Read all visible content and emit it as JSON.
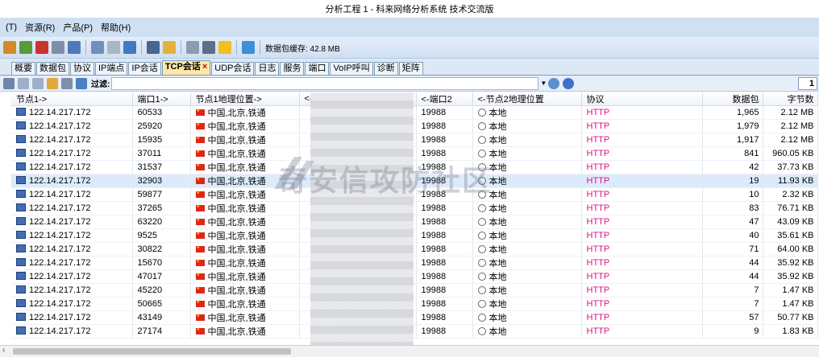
{
  "window": {
    "title": "分析工程 1 - 科来网络分析系统 技术交流版"
  },
  "menu": [
    "(T)",
    "资源(R)",
    "产品(P)",
    "帮助(H)"
  ],
  "toolbar": {
    "buffer_label": "数据包缓存: 42.8 MB"
  },
  "tabs": [
    {
      "label": "概要"
    },
    {
      "label": "数据包"
    },
    {
      "label": "协议"
    },
    {
      "label": "IP端点"
    },
    {
      "label": "IP会话"
    },
    {
      "label": "TCP会话",
      "active": true,
      "close": "×"
    },
    {
      "label": "UDP会话"
    },
    {
      "label": "日志"
    },
    {
      "label": "服务"
    },
    {
      "label": "端口"
    },
    {
      "label": "VoIP呼叫"
    },
    {
      "label": "诊断"
    },
    {
      "label": "矩阵"
    }
  ],
  "filter": {
    "label": "过滤:",
    "value": "",
    "page": "1"
  },
  "columns": {
    "node1": "节点1->",
    "port1": "端口1->",
    "geo1": "节点1地理位置->",
    "node2": "<-",
    "port2": "<-端口2",
    "geo2": "<-节点2地理位置",
    "protocol": "协议",
    "packets": "数据包",
    "bytes": "字节数"
  },
  "rows": [
    {
      "node1": "122.14.217.172",
      "port1": "60533",
      "geo1": "中国,北京,铁通",
      "port2": "19988",
      "geo2": "本地",
      "protocol": "HTTP",
      "packets": "1,965",
      "bytes": "2.12 MB"
    },
    {
      "node1": "122.14.217.172",
      "port1": "25920",
      "geo1": "中国,北京,铁通",
      "port2": "19988",
      "geo2": "本地",
      "protocol": "HTTP",
      "packets": "1,979",
      "bytes": "2.12 MB"
    },
    {
      "node1": "122.14.217.172",
      "port1": "15935",
      "geo1": "中国,北京,铁通",
      "port2": "19988",
      "geo2": "本地",
      "protocol": "HTTP",
      "packets": "1,917",
      "bytes": "2.12 MB"
    },
    {
      "node1": "122.14.217.172",
      "port1": "37011",
      "geo1": "中国,北京,铁通",
      "port2": "19988",
      "geo2": "本地",
      "protocol": "HTTP",
      "packets": "841",
      "bytes": "960.05 KB"
    },
    {
      "node1": "122.14.217.172",
      "port1": "31537",
      "geo1": "中国,北京,铁通",
      "port2": "19988",
      "geo2": "本地",
      "protocol": "HTTP",
      "packets": "42",
      "bytes": "37.73 KB"
    },
    {
      "node1": "122.14.217.172",
      "port1": "32903",
      "geo1": "中国,北京,铁通",
      "port2": "19988",
      "geo2": "本地",
      "protocol": "HTTP",
      "packets": "19",
      "bytes": "11.93 KB",
      "selected": true
    },
    {
      "node1": "122.14.217.172",
      "port1": "59877",
      "geo1": "中国,北京,铁通",
      "port2": "19988",
      "geo2": "本地",
      "protocol": "HTTP",
      "packets": "10",
      "bytes": "2.32 KB"
    },
    {
      "node1": "122.14.217.172",
      "port1": "37265",
      "geo1": "中国,北京,铁通",
      "port2": "19988",
      "geo2": "本地",
      "protocol": "HTTP",
      "packets": "83",
      "bytes": "76.71 KB"
    },
    {
      "node1": "122.14.217.172",
      "port1": "63220",
      "geo1": "中国,北京,铁通",
      "port2": "19988",
      "geo2": "本地",
      "protocol": "HTTP",
      "packets": "47",
      "bytes": "43.09 KB"
    },
    {
      "node1": "122.14.217.172",
      "port1": "9525",
      "geo1": "中国,北京,铁通",
      "port2": "19988",
      "geo2": "本地",
      "protocol": "HTTP",
      "packets": "40",
      "bytes": "35.61 KB"
    },
    {
      "node1": "122.14.217.172",
      "port1": "30822",
      "geo1": "中国,北京,铁通",
      "port2": "19988",
      "geo2": "本地",
      "protocol": "HTTP",
      "packets": "71",
      "bytes": "64.00 KB"
    },
    {
      "node1": "122.14.217.172",
      "port1": "15670",
      "geo1": "中国,北京,铁通",
      "port2": "19988",
      "geo2": "本地",
      "protocol": "HTTP",
      "packets": "44",
      "bytes": "35.92 KB"
    },
    {
      "node1": "122.14.217.172",
      "port1": "47017",
      "geo1": "中国,北京,铁通",
      "port2": "19988",
      "geo2": "本地",
      "protocol": "HTTP",
      "packets": "44",
      "bytes": "35.92 KB"
    },
    {
      "node1": "122.14.217.172",
      "port1": "45220",
      "geo1": "中国,北京,铁通",
      "port2": "19988",
      "geo2": "本地",
      "protocol": "HTTP",
      "packets": "7",
      "bytes": "1.47 KB"
    },
    {
      "node1": "122.14.217.172",
      "port1": "50665",
      "geo1": "中国,北京,铁通",
      "port2": "19988",
      "geo2": "本地",
      "protocol": "HTTP",
      "packets": "7",
      "bytes": "1.47 KB"
    },
    {
      "node1": "122.14.217.172",
      "port1": "43149",
      "geo1": "中国,北京,铁通",
      "port2": "19988",
      "geo2": "本地",
      "protocol": "HTTP",
      "packets": "57",
      "bytes": "50.77 KB"
    },
    {
      "node1": "122.14.217.172",
      "port1": "27174",
      "geo1": "中国,北京,铁通",
      "port2": "19988",
      "geo2": "本地",
      "protocol": "HTTP",
      "packets": "9",
      "bytes": "1.83 KB"
    }
  ],
  "watermark": "奇安信攻防社区",
  "colors": {
    "accent": "#cfe0f3",
    "protocol": "#e0138a",
    "selected_row": "#dcebfb",
    "active_tab": "#fde8a8"
  }
}
